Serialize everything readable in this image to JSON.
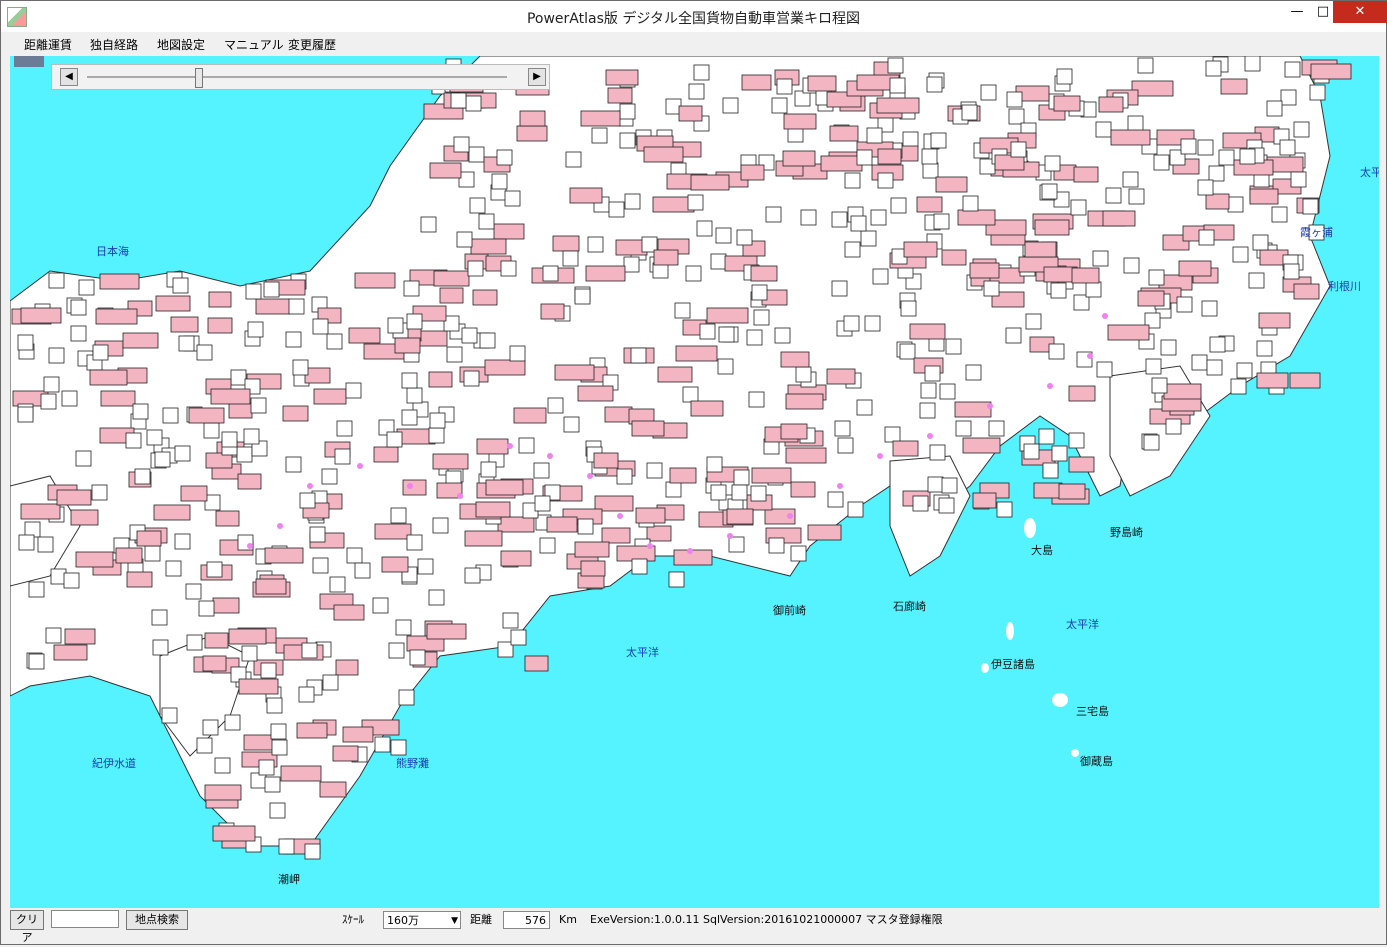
{
  "window": {
    "title": "PowerAtlas版 デジタル全国貨物自動車営業キロ程図",
    "controls": {
      "minimize": "—",
      "maximize": "□",
      "close": "✕"
    }
  },
  "menu": {
    "items": [
      "距離運賃",
      "独自経路",
      "地図設定",
      "マニュアル",
      "変更履歴"
    ]
  },
  "slider": {
    "left_arrow": "◀",
    "right_arrow": "▶",
    "level": 0.26
  },
  "map": {
    "sea_labels": [
      "日本海",
      "太平洋",
      "太平洋",
      "紀伊水道",
      "熊野灘",
      "太平",
      "利根川",
      "霞ヶ浦"
    ],
    "place_labels": [
      "大島",
      "野島崎",
      "石廊崎",
      "御前崎",
      "伊豆諸島",
      "三宅島",
      "御蔵島",
      "潮岬"
    ]
  },
  "status": {
    "clear_button": "クリア",
    "search_input": "",
    "search_button": "地点検索",
    "scale_label": "ｽｹｰﾙ",
    "scale_value": "160万",
    "distance_label": "距離",
    "distance_value": "576",
    "distance_unit": "Km",
    "version": "ExeVersion:1.0.0.11 SqlVersion:20161021000007 マスタ登録権限"
  },
  "colors": {
    "sea": "#55f2ff",
    "land": "#ffffff",
    "label_bg": "#f4b5c2",
    "route": "#ee82ee"
  }
}
